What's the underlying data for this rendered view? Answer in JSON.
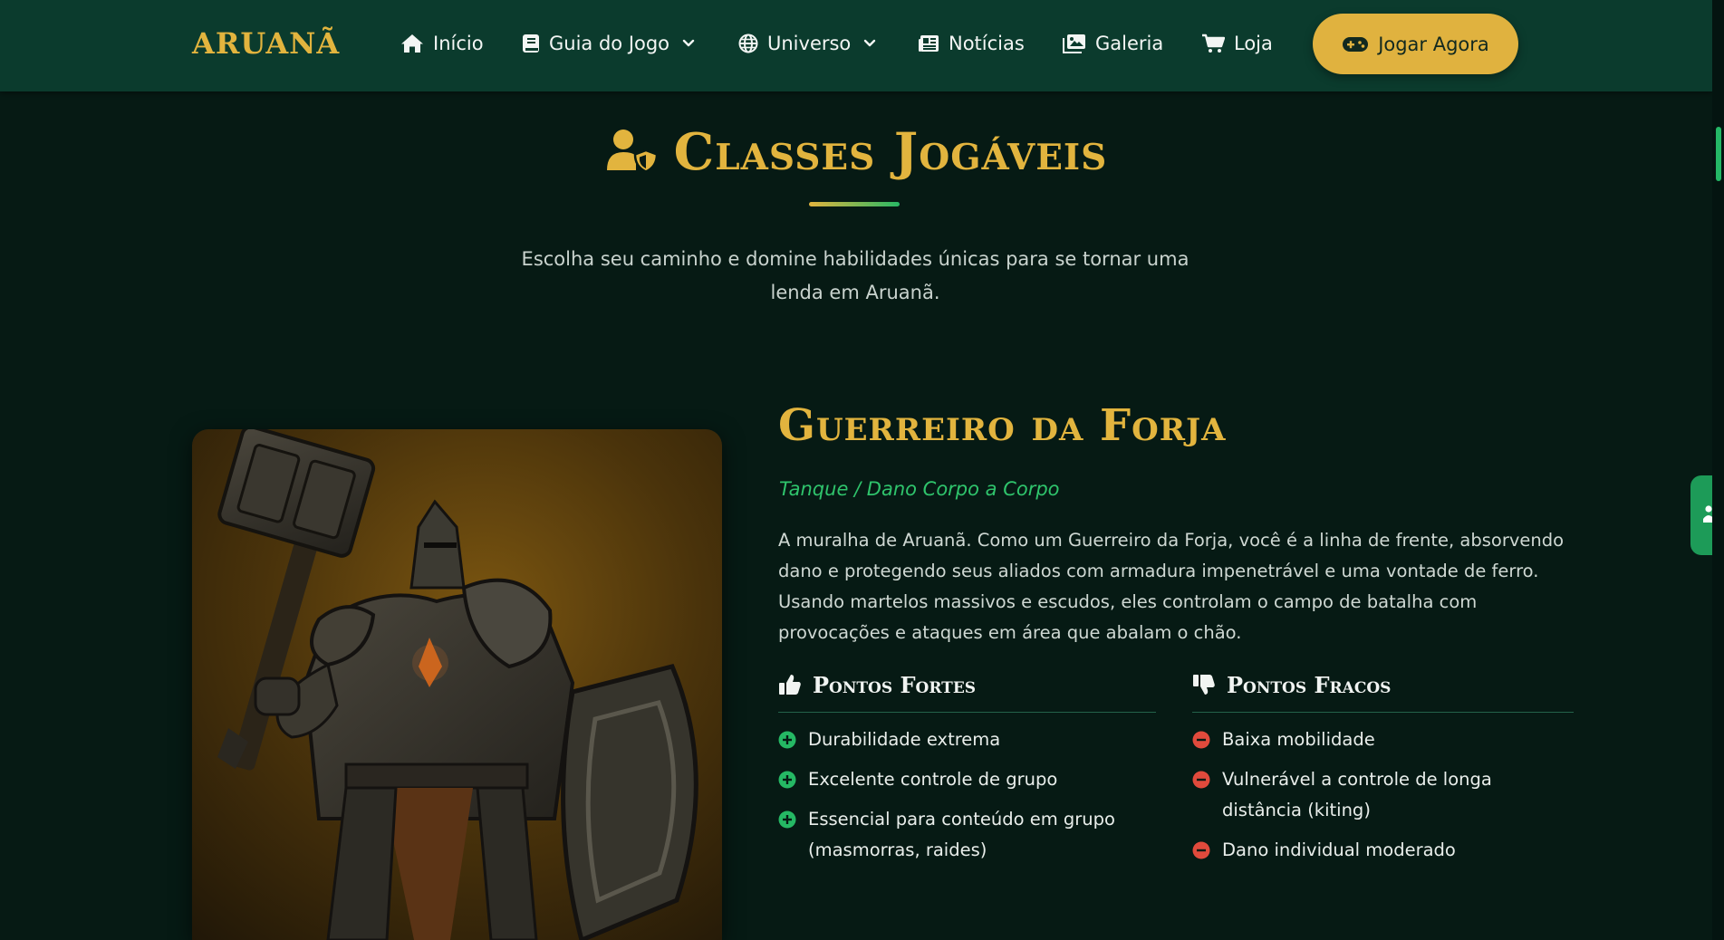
{
  "nav": {
    "logo": "ARUANÃ",
    "links": [
      {
        "label": "Início",
        "icon": "house-icon"
      },
      {
        "label": "Guia do Jogo",
        "icon": "book-icon",
        "dropdown": true
      },
      {
        "label": "Universo",
        "icon": "globe-icon",
        "dropdown": true
      },
      {
        "label": "Notícias",
        "icon": "newspaper-icon"
      },
      {
        "label": "Galeria",
        "icon": "images-icon"
      },
      {
        "label": "Loja",
        "icon": "cart-icon"
      }
    ],
    "cta_label": "Jogar Agora",
    "cta_icon": "gamepad-icon"
  },
  "section": {
    "title": "Classes Jogáveis",
    "title_icon": "user-shield-icon",
    "intro": "Escolha seu caminho e domine habilidades únicas para se tornar uma lenda em Aruanã."
  },
  "class": {
    "name": "Guerreiro da Forja",
    "role": "Tanque / Dano Corpo a Corpo",
    "description": "A muralha de Aruanã. Como um Guerreiro da Forja, você é a linha de frente, absorvendo dano e protegendo seus aliados com armadura impenetrável e uma vontade de ferro. Usando martelos massivos e escudos, eles controlam o campo de batalha com provocações e ataques em área que abalam o chão.",
    "strengths_title": "Pontos Fortes",
    "strengths_icon": "thumbs-up-icon",
    "strengths": [
      "Durabilidade extrema",
      "Excelente controle de grupo",
      "Essencial para conteúdo em grupo (masmorras, raides)"
    ],
    "weaknesses_title": "Pontos Fracos",
    "weaknesses_icon": "thumbs-down-icon",
    "weaknesses": [
      "Baixa mobilidade",
      "Vulnerável a controle de longa distância (kiting)",
      "Dano individual moderado"
    ]
  },
  "colors": {
    "navbar": "#0b3b2d",
    "background": "#061a14",
    "gold": "#e2b43e",
    "green_accent": "#2fc46c",
    "negative": "#e04a3c"
  }
}
